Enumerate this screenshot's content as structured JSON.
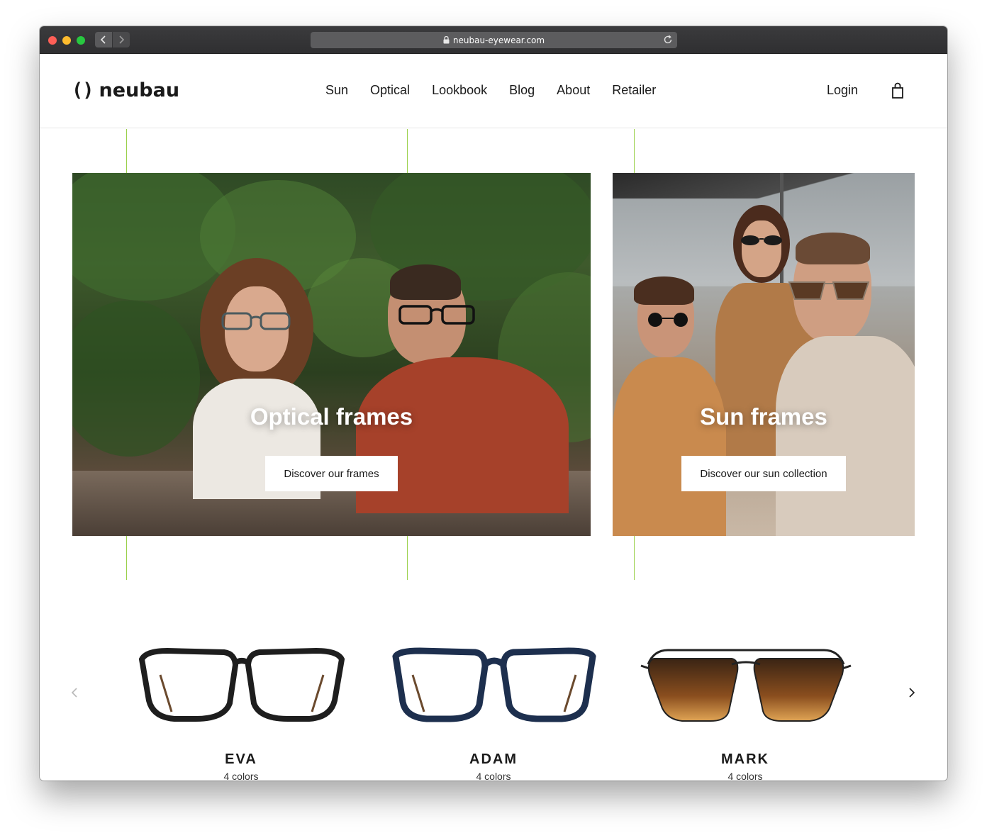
{
  "browser": {
    "url": "neubau-eyewear.com"
  },
  "site": {
    "logo_mark": "()",
    "logo_text": "neubau",
    "nav": [
      "Sun",
      "Optical",
      "Lookbook",
      "Blog",
      "About",
      "Retailer"
    ],
    "login": "Login"
  },
  "heroes": [
    {
      "title": "Optical frames",
      "button": "Discover our frames"
    },
    {
      "title": "Sun frames",
      "button": "Discover our sun collection"
    }
  ],
  "products": [
    {
      "name": "EVA",
      "colors": "4 colors",
      "frame_color": "#1e1e1e",
      "lens": "clear"
    },
    {
      "name": "ADAM",
      "colors": "4 colors",
      "frame_color": "#1d2f4e",
      "lens": "clear"
    },
    {
      "name": "MARK",
      "colors": "4 colors",
      "frame_color": "#222222",
      "lens": "gradient-brown"
    }
  ],
  "colors": {
    "accent_line": "#9ad04a",
    "text": "#1a1a1a"
  }
}
